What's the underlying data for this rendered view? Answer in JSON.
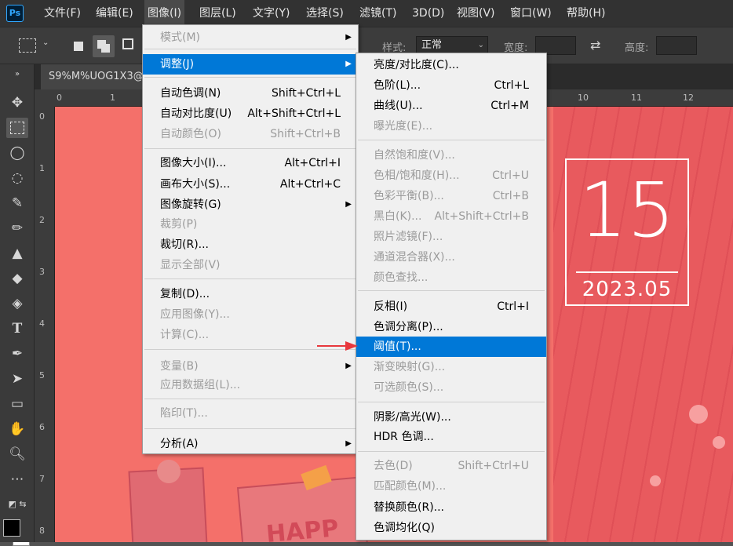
{
  "app": {
    "logo_text": "Ps"
  },
  "menubar": {
    "items": [
      "文件(F)",
      "编辑(E)",
      "图像(I)",
      "图层(L)",
      "文字(Y)",
      "选择(S)",
      "滤镜(T)",
      "3D(D)",
      "视图(V)",
      "窗口(W)",
      "帮助(H)"
    ],
    "active_index": 2
  },
  "options_bar": {
    "style_label": "样式:",
    "style_value": "正常",
    "width_label": "宽度:",
    "height_label": "高度:"
  },
  "document": {
    "tab_title": "S9%M%UOG1X3@"
  },
  "rulers": {
    "horizontal_ticks": [
      "0",
      "1",
      "10",
      "11",
      "12"
    ],
    "vertical_ticks": [
      "0",
      "1",
      "2",
      "3",
      "4",
      "5",
      "6",
      "7",
      "8"
    ]
  },
  "canvas": {
    "day": "15",
    "month": "2023.05",
    "note_text": "HAPP"
  },
  "image_menu": {
    "items": [
      {
        "label": "模式(M)",
        "shortcut": "",
        "submenu": true,
        "disabled": true
      },
      {
        "label": "调整(J)",
        "shortcut": "",
        "submenu": true,
        "highlighted": true
      },
      {
        "label": "自动色调(N)",
        "shortcut": "Shift+Ctrl+L"
      },
      {
        "label": "自动对比度(U)",
        "shortcut": "Alt+Shift+Ctrl+L"
      },
      {
        "label": "自动颜色(O)",
        "shortcut": "Shift+Ctrl+B",
        "disabled": true
      },
      {
        "label": "图像大小(I)...",
        "shortcut": "Alt+Ctrl+I"
      },
      {
        "label": "画布大小(S)...",
        "shortcut": "Alt+Ctrl+C"
      },
      {
        "label": "图像旋转(G)",
        "shortcut": "",
        "submenu": true
      },
      {
        "label": "裁剪(P)",
        "shortcut": "",
        "disabled": true
      },
      {
        "label": "裁切(R)...",
        "shortcut": ""
      },
      {
        "label": "显示全部(V)",
        "shortcut": "",
        "disabled": true
      },
      {
        "label": "复制(D)...",
        "shortcut": ""
      },
      {
        "label": "应用图像(Y)...",
        "shortcut": "",
        "disabled": true
      },
      {
        "label": "计算(C)...",
        "shortcut": "",
        "disabled": true
      },
      {
        "label": "变量(B)",
        "shortcut": "",
        "submenu": true,
        "disabled": true
      },
      {
        "label": "应用数据组(L)...",
        "shortcut": "",
        "disabled": true
      },
      {
        "label": "陷印(T)...",
        "shortcut": "",
        "disabled": true
      },
      {
        "label": "分析(A)",
        "shortcut": "",
        "submenu": true
      }
    ]
  },
  "adjust_menu": {
    "items": [
      {
        "label": "亮度/对比度(C)...",
        "shortcut": ""
      },
      {
        "label": "色阶(L)...",
        "shortcut": "Ctrl+L"
      },
      {
        "label": "曲线(U)...",
        "shortcut": "Ctrl+M"
      },
      {
        "label": "曝光度(E)...",
        "shortcut": "",
        "disabled": true
      },
      {
        "label": "自然饱和度(V)...",
        "shortcut": "",
        "disabled": true
      },
      {
        "label": "色相/饱和度(H)...",
        "shortcut": "Ctrl+U",
        "disabled": true
      },
      {
        "label": "色彩平衡(B)...",
        "shortcut": "Ctrl+B",
        "disabled": true
      },
      {
        "label": "黑白(K)...",
        "shortcut": "Alt+Shift+Ctrl+B",
        "disabled": true
      },
      {
        "label": "照片滤镜(F)...",
        "shortcut": "",
        "disabled": true
      },
      {
        "label": "通道混合器(X)...",
        "shortcut": "",
        "disabled": true
      },
      {
        "label": "颜色查找...",
        "shortcut": "",
        "disabled": true
      },
      {
        "label": "反相(I)",
        "shortcut": "Ctrl+I"
      },
      {
        "label": "色调分离(P)...",
        "shortcut": ""
      },
      {
        "label": "阈值(T)...",
        "shortcut": "",
        "highlighted": true
      },
      {
        "label": "渐变映射(G)...",
        "shortcut": "",
        "disabled": true
      },
      {
        "label": "可选颜色(S)...",
        "shortcut": "",
        "disabled": true
      },
      {
        "label": "阴影/高光(W)...",
        "shortcut": ""
      },
      {
        "label": "HDR 色调...",
        "shortcut": ""
      },
      {
        "label": "去色(D)",
        "shortcut": "Shift+Ctrl+U",
        "disabled": true
      },
      {
        "label": "匹配颜色(M)...",
        "shortcut": "",
        "disabled": true
      },
      {
        "label": "替换颜色(R)...",
        "shortcut": ""
      },
      {
        "label": "色调均化(Q)",
        "shortcut": ""
      }
    ]
  },
  "colors": {
    "highlight": "#0078d7",
    "canvas_bg": "#f4706a",
    "annotation_arrow": "#e8383d"
  }
}
